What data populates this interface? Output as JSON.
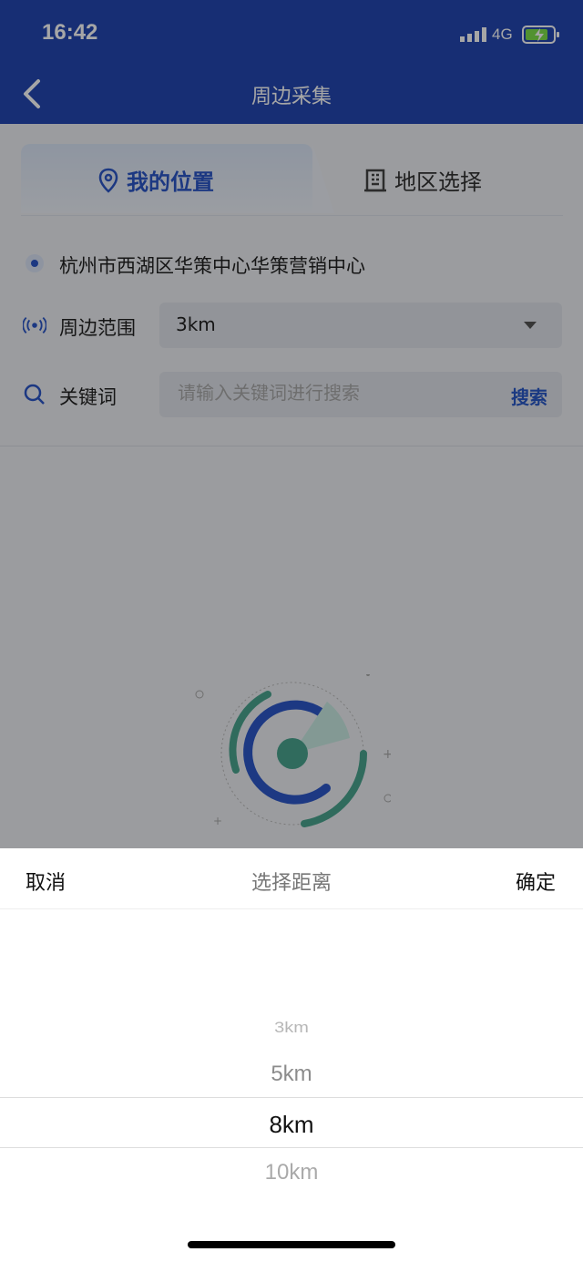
{
  "status": {
    "time": "16:42",
    "network": "4G"
  },
  "nav": {
    "title": "周边采集"
  },
  "tabs": [
    {
      "label": "我的位置",
      "icon": "map-pin-icon"
    },
    {
      "label": "地区选择",
      "icon": "building-icon"
    }
  ],
  "location": {
    "address": "杭州市西湖区华策中心华策营销中心"
  },
  "range": {
    "label": "周边范围",
    "value": "3km"
  },
  "keyword": {
    "label": "关键词",
    "placeholder": "请输入关键词进行搜索",
    "button": "搜索"
  },
  "picker": {
    "cancel": "取消",
    "title": "选择距离",
    "confirm": "确定",
    "options": [
      "3km",
      "5km",
      "8km",
      "10km"
    ],
    "selected": "8km"
  },
  "colors": {
    "primary": "#2448b3",
    "accent": "#2b56c8",
    "background": "#eef0f5"
  }
}
